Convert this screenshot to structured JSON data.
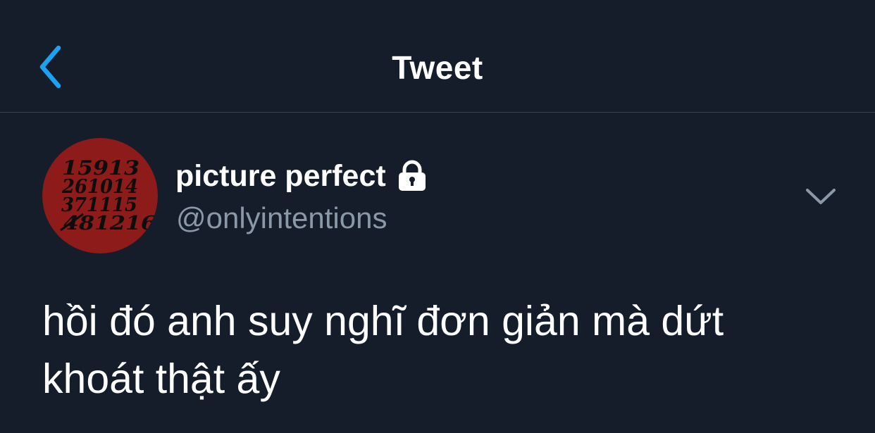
{
  "header": {
    "title": "Tweet",
    "back_icon": "chevron-left-icon",
    "accent_color": "#1da1f2"
  },
  "author": {
    "display_name": "picture perfect",
    "handle": "@onlyintentions",
    "protected_icon": "lock-icon",
    "avatar": {
      "background_color": "#8d1b19",
      "rows": [
        "15913",
        "261014",
        "371115",
        "481216"
      ]
    }
  },
  "more_icon": "chevron-down-icon",
  "tweet": {
    "text": "hồi đó anh suy nghĩ đơn giản mà dứt khoát thật ấy"
  },
  "colors": {
    "background": "#151d2a",
    "divider": "#39414d",
    "secondary_text": "#8a98a8"
  }
}
